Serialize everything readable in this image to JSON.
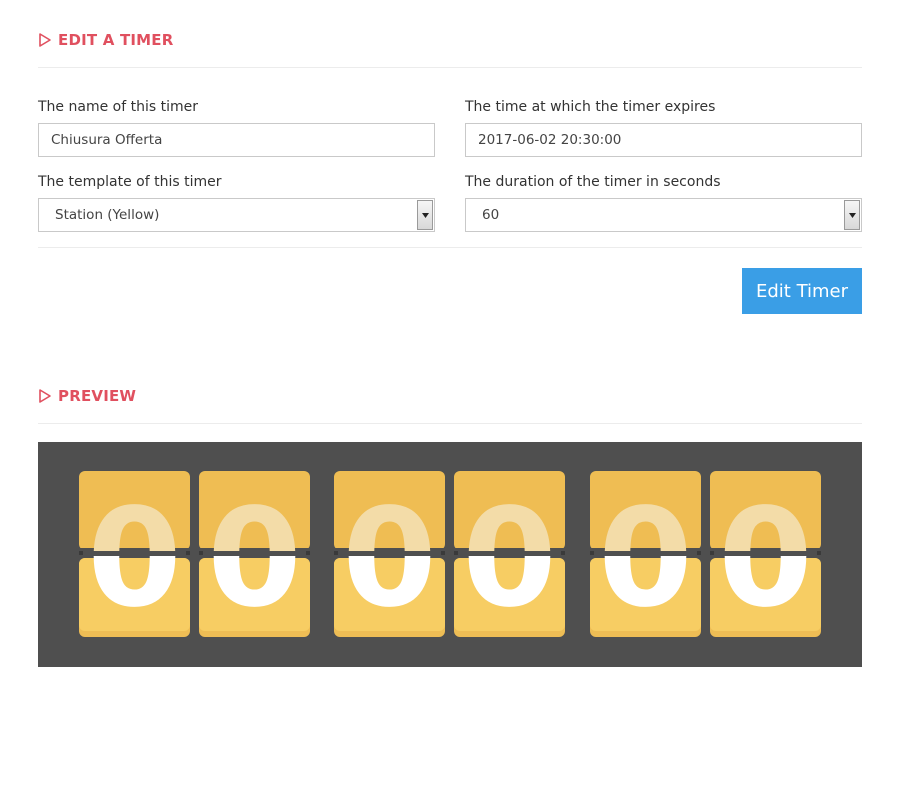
{
  "edit_section": {
    "title": "EDIT A TIMER",
    "name_label": "The name of this timer",
    "name_value": "Chiusura Offerta",
    "expires_label": "The time at which the timer expires",
    "expires_value": "2017-06-02 20:30:00",
    "template_label": "The template of this timer",
    "template_value": "Station (Yellow)",
    "duration_label": "The duration of the timer in seconds",
    "duration_value": "60",
    "submit_label": "Edit Timer"
  },
  "preview_section": {
    "title": "PREVIEW",
    "digits": [
      "0",
      "0",
      "0",
      "0",
      "0",
      "0"
    ]
  },
  "colors": {
    "accent": "#e0505f",
    "button": "#3a9ee6",
    "preview_bg": "#4f4f4f",
    "card_yellow": "#f6c95a"
  }
}
